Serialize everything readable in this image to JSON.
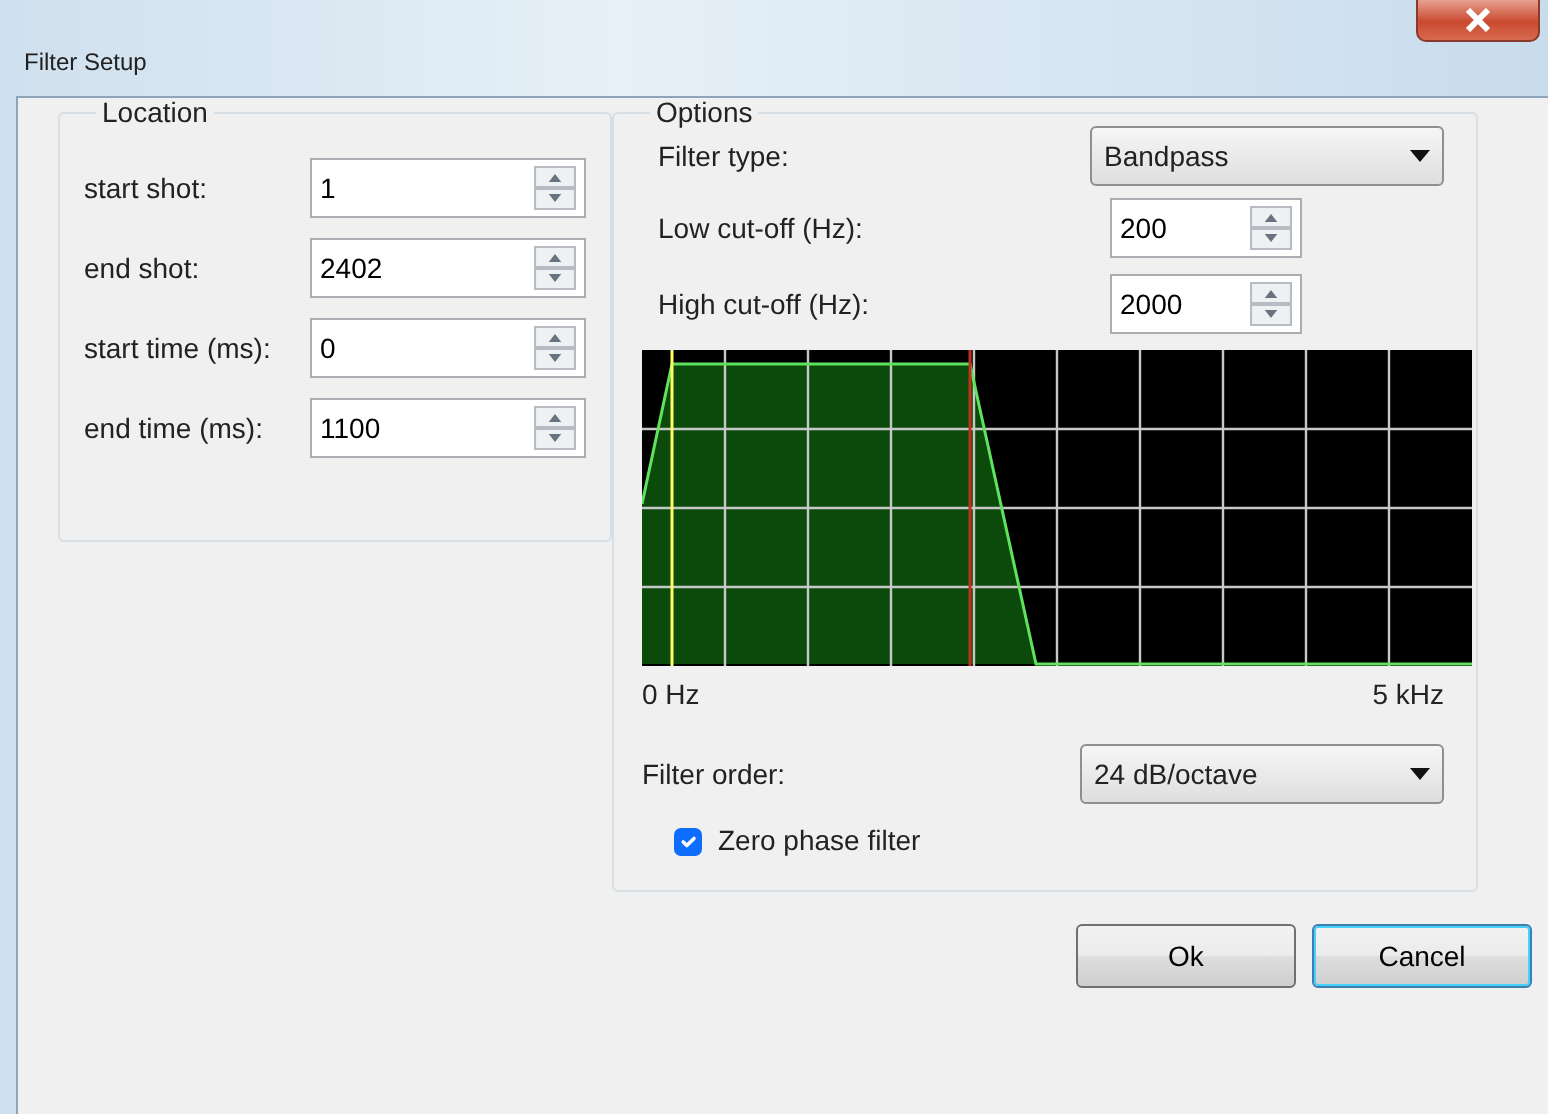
{
  "window": {
    "title": "Filter Setup"
  },
  "location": {
    "title": "Location",
    "groups": [
      [
        {
          "label": "start shot:",
          "value": "1"
        },
        {
          "label": "end shot:",
          "value": "2402"
        }
      ],
      [
        {
          "label": "start time (ms):",
          "value": "0"
        },
        {
          "label": "end time (ms):",
          "value": "1100"
        }
      ]
    ]
  },
  "options": {
    "title": "Options",
    "filter_type": {
      "label": "Filter type:",
      "value": "Bandpass"
    },
    "cutoffs": [
      {
        "label": "Low cut-off (Hz):",
        "value": "200"
      },
      {
        "label": "High cut-off (Hz):",
        "value": "2000"
      }
    ],
    "response": {
      "x_start": "0 Hz",
      "x_end": "5 kHz"
    },
    "filter_order": {
      "label": "Filter order:",
      "value": "24 dB/octave"
    },
    "zero_phase": {
      "label": "Zero phase filter",
      "checked": true
    }
  },
  "buttons": [
    {
      "label": "Ok",
      "default": false
    },
    {
      "label": "Cancel",
      "default": true
    }
  ]
}
